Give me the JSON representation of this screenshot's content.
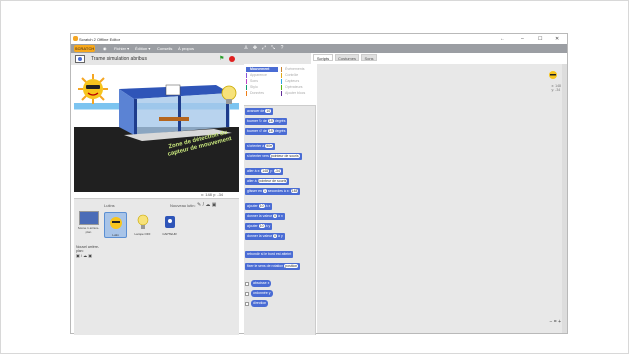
{
  "window": {
    "title": "Scratch 2 Offline Editor",
    "controls": [
      "←",
      "–",
      "☐",
      "✕"
    ]
  },
  "menu": {
    "logo": "SCRATCH",
    "items": [
      "Fichier ▾",
      "Édition ▾",
      "Conseils",
      "À propos"
    ],
    "globe_icon": "globe-icon",
    "tools": [
      "♙",
      "✥",
      "⤢",
      "⤡",
      "?"
    ]
  },
  "stage": {
    "project_title": "Trame simulation abribus",
    "zone_text": "Zone de détection du capteur de mouvement",
    "coords": "x: 148  y: -34"
  },
  "sprites": {
    "header": "Lutins",
    "new_sprite": "Nouveau lutin:",
    "stage_label": "Scène\n1 arrière-plan",
    "new_backdrop": "Nouvel arrière-plan:",
    "items": [
      {
        "name": "Lutin"
      },
      {
        "name": "Lampe OFF"
      },
      {
        "name": "CAPTEUR"
      }
    ]
  },
  "tabs": [
    "Scripts",
    "Costumes",
    "Sons"
  ],
  "categories": [
    {
      "label": "Mouvement",
      "color": "#4a6cd4",
      "active": true
    },
    {
      "label": "Apparence",
      "color": "#8a55d7"
    },
    {
      "label": "Sons",
      "color": "#bb42c3"
    },
    {
      "label": "Stylo",
      "color": "#0e9a6c"
    },
    {
      "label": "Données",
      "color": "#ee7d16"
    },
    {
      "label": "Événements",
      "color": "#c88330"
    },
    {
      "label": "Contrôle",
      "color": "#e1a91a"
    },
    {
      "label": "Capteurs",
      "color": "#2ca5e2"
    },
    {
      "label": "Opérateurs",
      "color": "#5cb712"
    },
    {
      "label": "Ajouter blocs",
      "color": "#632d99"
    }
  ],
  "blocks": [
    {
      "text": "avancer de",
      "num": "10"
    },
    {
      "text": "tourner ↻ de",
      "num": "15",
      "suffix": "degrés"
    },
    {
      "text": "tourner ↺ de",
      "num": "15",
      "suffix": "degrés"
    },
    {
      "text": "s'orienter à",
      "num": "90▾"
    },
    {
      "text": "s'orienter vers",
      "suffix": "pointeur de souris"
    },
    {
      "text": "aller à x:",
      "num": "148",
      "suffix": "y:",
      "num2": "-34"
    },
    {
      "text": "aller à",
      "suffix": "pointeur de souris"
    },
    {
      "text": "glisser en",
      "num": "1",
      "suffix": "secondes à x:",
      "num2": "148"
    },
    {
      "text": "ajouter",
      "num": "10",
      "suffix": "à x"
    },
    {
      "text": "donner la valeur",
      "num": "0",
      "suffix": "à x"
    },
    {
      "text": "ajouter",
      "num": "10",
      "suffix": "à y"
    },
    {
      "text": "donner la valeur",
      "num": "0",
      "suffix": "à y"
    },
    {
      "text": "rebondir si le bord est atteint"
    },
    {
      "text": "fixer le sens de rotation",
      "suffix": "position"
    },
    {
      "text": "abscisse x",
      "check": true
    },
    {
      "text": "ordonnée y",
      "check": true
    },
    {
      "text": "direction",
      "check": true
    }
  ],
  "scripts_area": {
    "xy": [
      "x: 148",
      "y: -34"
    ],
    "zoom": [
      "−",
      "=",
      "+"
    ]
  }
}
